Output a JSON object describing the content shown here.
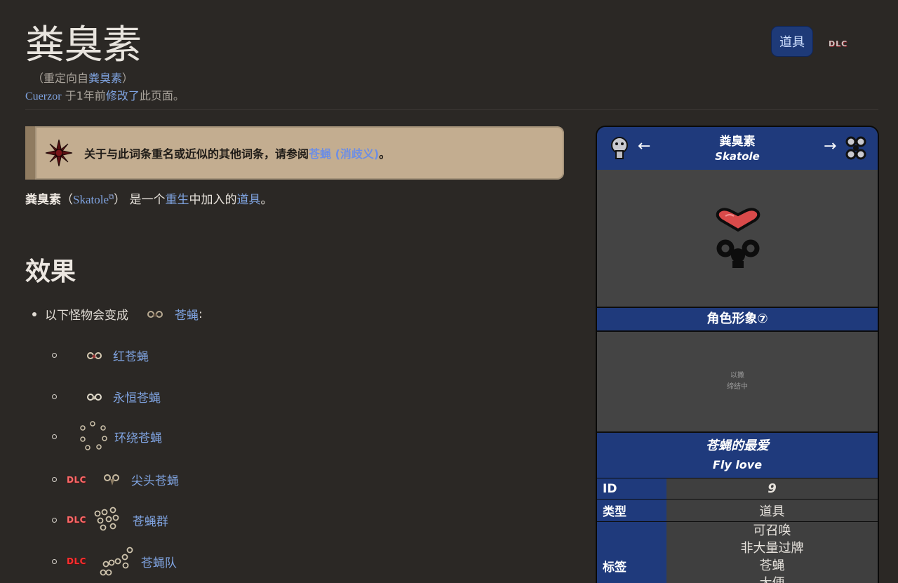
{
  "page": {
    "title": "粪臭素",
    "redirect_prefix": "（重定向自",
    "redirect_link": "粪臭素",
    "redirect_suffix": "）",
    "editor": "Cuerzor",
    "edit_mid": " 于1年前",
    "edit_link": "修改了",
    "edit_suffix": "此页面。"
  },
  "header_buttons": {
    "item_label": "道具",
    "dlc_label": "DLC"
  },
  "notice": {
    "prefix": "关于与此词条重名或近似的其他词条，请参阅",
    "link": "苍蝇 (消歧义)",
    "suffix": "。"
  },
  "intro": {
    "name": "粪臭素",
    "open": "（",
    "english": "Skatole",
    "close": "）",
    "mid": " 是一个",
    "link1": "重生",
    "mid2": "中加入的",
    "link2": "道具",
    "end": "。"
  },
  "section": {
    "title": "效果"
  },
  "list": {
    "lead": "以下怪物会变成",
    "lead_link": "苍蝇",
    "lead_colon": ":",
    "items": [
      {
        "dlc": "",
        "label": "红苍蝇"
      },
      {
        "dlc": "",
        "label": "永恒苍蝇"
      },
      {
        "dlc": "",
        "label": "环绕苍蝇"
      },
      {
        "dlc": "DLC",
        "label": "尖头苍蝇"
      },
      {
        "dlc": "DLC",
        "label": "苍蝇群"
      },
      {
        "dlc": "DLC",
        "label": "苍蝇队"
      }
    ]
  },
  "infobox": {
    "name": "粪臭素",
    "name_en": "Skatole",
    "prev_arrow": "←",
    "next_arrow": "→",
    "character_band": "角色形象⑦",
    "placeholder_l1": "以撒",
    "placeholder_l2": "缔结中",
    "quote": "苍蝇的最爱",
    "quote_en": "Fly love",
    "rows": {
      "id_key": "ID",
      "id_val": "9",
      "type_key": "类型",
      "type_val": "道具",
      "tags_key": "标签",
      "tags": [
        "可召唤",
        "非大量过牌",
        "苍蝇",
        "大便"
      ]
    }
  },
  "colors": {
    "accent_blue": "#1f3a7c",
    "link": "#7fa3e0",
    "background": "#2b2825",
    "notice": "#c3ad90"
  }
}
